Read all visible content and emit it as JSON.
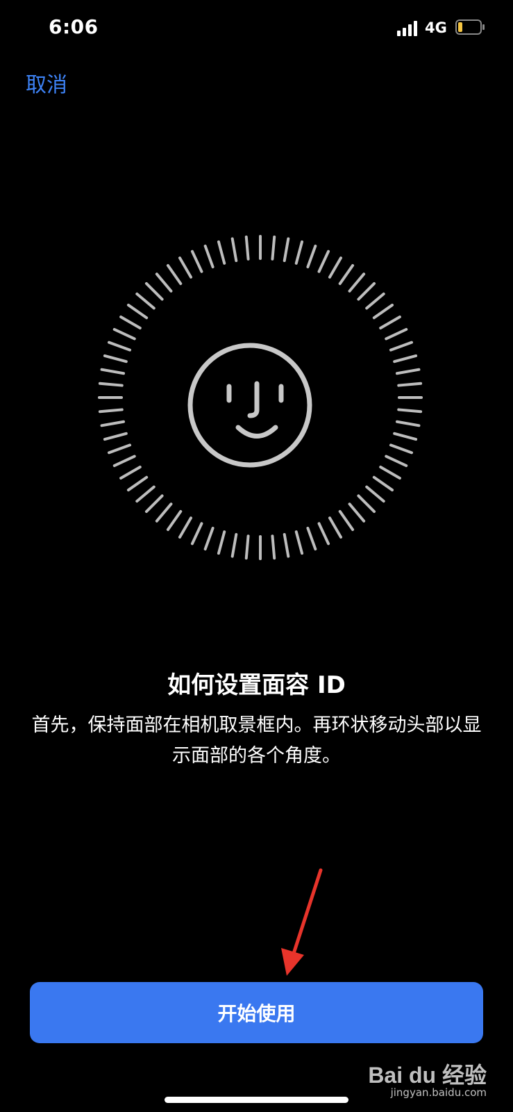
{
  "status_bar": {
    "time": "6:06",
    "network": "4G",
    "battery_level": 0.2,
    "battery_color": "#f5c542"
  },
  "nav": {
    "cancel_label": "取消"
  },
  "face_id": {
    "icon": "face-id-icon",
    "ring_color": "#bdbdbd"
  },
  "content": {
    "title": "如何设置面容 ID",
    "description": "首先，保持面部在相机取景框内。再环状移动头部以显示面部的各个角度。"
  },
  "actions": {
    "start_label": "开始使用",
    "accent_color": "#3a78f0"
  },
  "watermark": {
    "brand": "Bai du 经验",
    "url": "jingyan.baidu.com"
  }
}
